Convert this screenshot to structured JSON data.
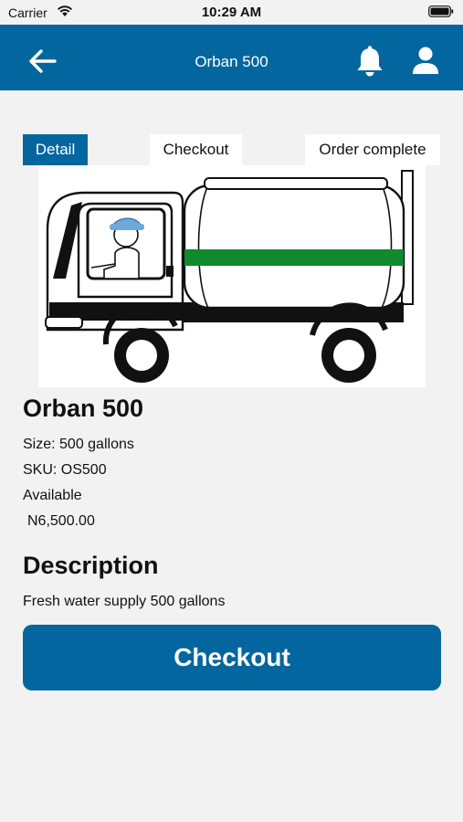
{
  "status_bar": {
    "carrier": "Carrier",
    "time": "10:29 AM",
    "wifi_icon": "wifi-icon",
    "battery_icon": "battery-icon"
  },
  "header": {
    "title": "Orban 500",
    "back_icon": "arrow-left-icon",
    "notification_icon": "bell-icon",
    "profile_icon": "user-icon",
    "background_color": "#03669e"
  },
  "steps": [
    {
      "label": "Detail",
      "active": true
    },
    {
      "label": "Checkout",
      "active": false
    },
    {
      "label": "Order complete",
      "active": false
    }
  ],
  "product": {
    "name": "Orban 500",
    "size": "Size: 500 gallons",
    "sku": "SKU: OS500",
    "availability": "Available",
    "price": "N6,500.00",
    "image": "water-tanker-truck-illustration",
    "tank_stripe_color": "#0f8a2e"
  },
  "description": {
    "heading": "Description",
    "text": "Fresh water supply 500 gallons"
  },
  "checkout_button": {
    "label": "Checkout"
  }
}
